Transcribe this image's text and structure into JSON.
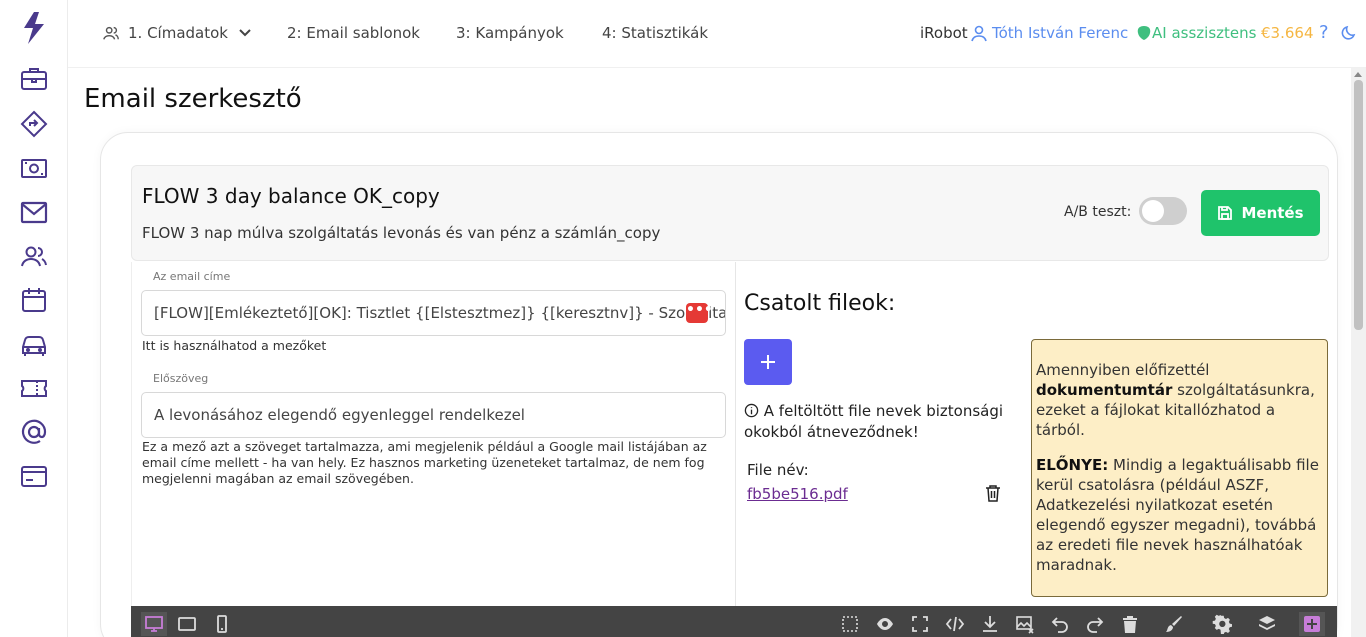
{
  "nav": {
    "items": [
      {
        "label": "1. Címadatok"
      },
      {
        "label": "2: Email sablonok"
      },
      {
        "label": "3: Kampányok"
      },
      {
        "label": "4: Statisztikák"
      }
    ]
  },
  "topright": {
    "brand": "iRobot",
    "user": "Tóth István Ferenc",
    "ai": "AI asszisztens",
    "balance": "€3.664",
    "help": "?"
  },
  "page": {
    "title": "Email szerkesztő"
  },
  "email": {
    "name": "FLOW 3 day balance OK_copy",
    "description": "FLOW 3 nap múlva szolgáltatás levonás és van pénz a számlán_copy",
    "ab_label": "A/B teszt:",
    "ab_enabled": false,
    "save_label": "Mentés",
    "subject_label": "Az email címe",
    "subject_value": "[FLOW][Emlékeztető][OK]: Tisztlet {[Elstesztmez]} {[keresztnv]} - Szolgáltatás",
    "subject_help": "Itt is használhatod a mezőket",
    "preheader_label": "Előszöveg",
    "preheader_value": "A levonásához elegendő egyenleggel rendelkezel",
    "preheader_help": "Ez a mező azt a szöveget tartalmazza, ami megjelenik például a Google mail listájában az email címe mellett - ha van hely. Ez hasznos marketing üzeneteket tartalmaz, de nem fog megjelenni magában az email szövegében."
  },
  "attachments": {
    "title": "Csatolt fileok:",
    "info": "A feltöltött file nevek biztonsági okokból átneveződnek!",
    "file_label": "File név:",
    "files": [
      {
        "name": "fb5be516.pdf"
      }
    ]
  },
  "notice": {
    "p1_a": "Amennyiben előfizettél",
    "p1_bold": "dokumentumtár",
    "p1_b": "szolgáltatásunkra, ezeket a fájlokat kitallózhatod a tárból.",
    "p2_bold": "ELŐNYE:",
    "p2_b": "Mindig a legaktuálisabb file kerül csatolásra (például ASZF, Adatkezelési nyilatkozat esetén elegendő egyszer megadni), továbbá az eredeti file nevek használhatóak maradnak."
  },
  "colors": {
    "accent": "#5b5bf0",
    "save": "#1fc36b",
    "user": "#5b8def",
    "ai": "#3fbf7f",
    "balance": "#f5b642",
    "notice_bg": "#fdeec6",
    "toolbar": "#444444"
  }
}
